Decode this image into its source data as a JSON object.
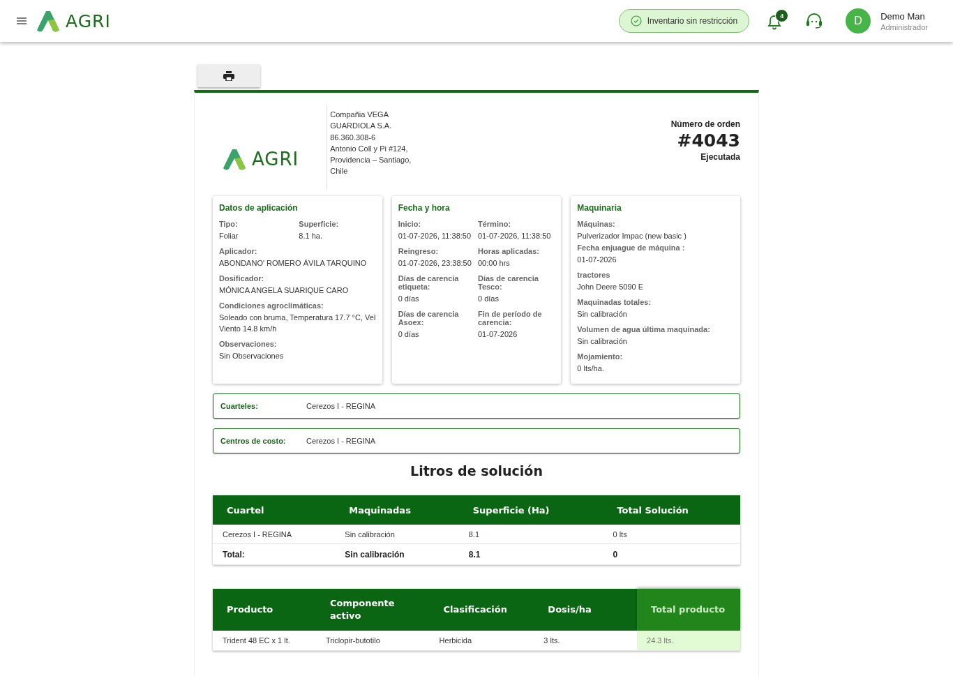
{
  "topbar": {
    "brand": "AGRI",
    "status_chip": "Inventario sin restricción",
    "notification_count": "4",
    "user": {
      "initial": "D",
      "name": "Demo Man",
      "role": "Administrador"
    }
  },
  "order": {
    "brand": "AGRI",
    "company_lines": [
      "Compañia VEGA",
      "GUARDIOLA S.A.",
      "86.360.308-6",
      "Antonio Coll y Pi #124,",
      "Providencia – Santiago,",
      "Chile"
    ],
    "order_label": "Número de orden",
    "order_number": "#4043",
    "order_status": "Ejecutada"
  },
  "cards": [
    {
      "title": "Datos de aplicación",
      "rows": [
        {
          "kind": "columns",
          "fields": [
            {
              "label": "Tipo:",
              "value": "Foliar"
            },
            {
              "label": "Superficie:",
              "value": "8.1 ha."
            }
          ]
        },
        {
          "kind": "columns",
          "fields": [
            {
              "label": "Aplicador:",
              "value": "ABONDANO' ROMERO ÁVILA TARQUINO"
            }
          ]
        },
        {
          "kind": "columns",
          "fields": [
            {
              "label": "Dosificador:",
              "value": "MÓNICA ANGELA SUARIQUE CARO"
            }
          ]
        },
        {
          "kind": "columns",
          "fields": [
            {
              "label": "Condiciones agroclimáticas:",
              "value": "Soleado con bruma, Temperatura 17.7 °C, Vel Viento 14.8 km/h"
            }
          ]
        },
        {
          "kind": "columns",
          "fields": [
            {
              "label": "Observaciones:",
              "value": "Sin Observaciones"
            }
          ]
        }
      ]
    },
    {
      "title": "Fecha y hora",
      "rows": [
        {
          "kind": "columns",
          "fields": [
            {
              "label": "Inicio:",
              "value": "01-07-2026, 11:38:50"
            },
            {
              "label": "Término:",
              "value": "01-07-2026, 11:38:50"
            }
          ]
        },
        {
          "kind": "columns",
          "fields": [
            {
              "label": "Reingreso:",
              "value": "01-07-2026, 23:38:50"
            },
            {
              "label": "Horas aplicadas:",
              "value": "00:00 hrs"
            }
          ]
        },
        {
          "kind": "columns",
          "fields": [
            {
              "label": "Días de carencia etiqueta:",
              "value": "0 días"
            },
            {
              "label": "Días de carencia Tesco:",
              "value": "0 días"
            }
          ]
        },
        {
          "kind": "columns",
          "fields": [
            {
              "label": "Días de carencia Asoex:",
              "value": "0 días"
            },
            {
              "label": "Fin de período de carencia:",
              "value": "01-07-2026"
            }
          ]
        }
      ]
    },
    {
      "title": "Maquinaria",
      "rows": [
        {
          "kind": "stack",
          "fields": [
            {
              "label": "Máquinas:",
              "value": "Pulverizador Impac (new basic )"
            },
            {
              "label": "Fecha enjuague de máquina :",
              "value": "01-07-2026"
            }
          ]
        },
        {
          "kind": "columns",
          "fields": [
            {
              "label": "tractores",
              "value": "John Deere 5090 E"
            }
          ]
        },
        {
          "kind": "columns",
          "fields": [
            {
              "label": "Maquinadas totales:",
              "value": "Sin calibración"
            }
          ]
        },
        {
          "kind": "columns",
          "fields": [
            {
              "label": "Volumen de agua última maquinada:",
              "value": "Sin calibración"
            }
          ]
        },
        {
          "kind": "columns",
          "fields": [
            {
              "label": "Mojamiento:",
              "value": "0 lts/ha."
            }
          ]
        }
      ]
    }
  ],
  "info_boxes": [
    {
      "label": "Cuarteles:",
      "value": "Cerezos I - REGINA"
    },
    {
      "label": "Centros de costo:",
      "value": "Cerezos I - REGINA"
    }
  ],
  "solution_table": {
    "title": "Litros de solución",
    "columns": [
      "Cuartel",
      "Maquinadas",
      "Superficie (Ha)",
      "Total Solución"
    ],
    "rows": [
      [
        "Cerezos I - REGINA",
        "Sin calibración",
        "8.1",
        "0 lts"
      ]
    ],
    "total_row": [
      "Total:",
      "Sin calibración",
      "8.1",
      "0"
    ]
  },
  "product_table": {
    "columns": [
      {
        "label": "Producto",
        "highlighted": false
      },
      {
        "label": "Componente activo",
        "highlighted": false
      },
      {
        "label": "Clasificación",
        "highlighted": false
      },
      {
        "label": "Dosis/ha",
        "highlighted": false
      },
      {
        "label": "Total producto",
        "highlighted": true
      }
    ],
    "rows": [
      [
        "Trident 48 EC x 1 lt.",
        "Triclopir-butotilo",
        "Herbicida",
        "3 lts.",
        "24.3 lts."
      ]
    ]
  }
}
